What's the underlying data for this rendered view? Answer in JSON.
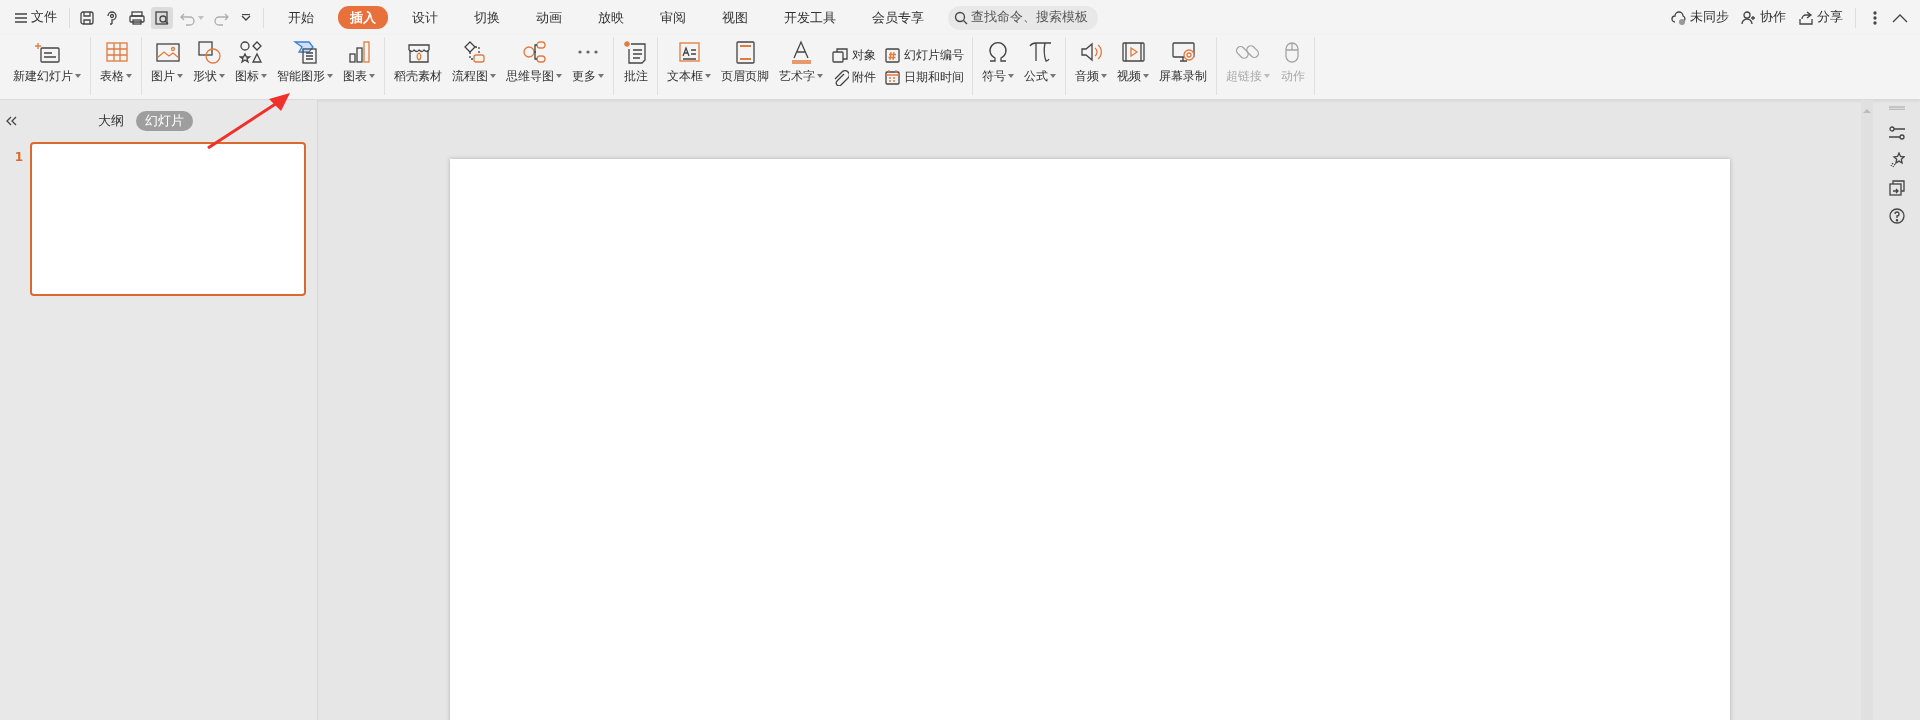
{
  "menu": {
    "file": "文件"
  },
  "quick_access": [
    {
      "selected": false,
      "disabled": false,
      "dropdown": false
    },
    {
      "selected": false,
      "disabled": false,
      "dropdown": false
    },
    {
      "selected": false,
      "disabled": false,
      "dropdown": false
    },
    {
      "selected": true,
      "disabled": false,
      "dropdown": false
    },
    {
      "selected": false,
      "disabled": true,
      "dropdown": true
    },
    {
      "selected": false,
      "disabled": true,
      "dropdown": false
    }
  ],
  "tabs": [
    {
      "label": "开始",
      "selected": false
    },
    {
      "label": "插入",
      "selected": true
    },
    {
      "label": "设计",
      "selected": false
    },
    {
      "label": "切换",
      "selected": false
    },
    {
      "label": "动画",
      "selected": false
    },
    {
      "label": "放映",
      "selected": false
    },
    {
      "label": "审阅",
      "selected": false
    },
    {
      "label": "视图",
      "selected": false
    },
    {
      "label": "开发工具",
      "selected": false
    },
    {
      "label": "会员专享",
      "selected": false
    }
  ],
  "search": {
    "placeholder": "查找命令、搜索模板"
  },
  "actions": [
    {
      "label": "未同步"
    },
    {
      "label": "协作"
    },
    {
      "label": "分享"
    }
  ],
  "ribbon": {
    "groups": [
      {
        "items": [
          {
            "kind": "big",
            "label": "新建幻灯片",
            "dropdown": true,
            "disabled": false
          }
        ]
      },
      {
        "items": [
          {
            "kind": "big",
            "label": "表格",
            "dropdown": true,
            "disabled": false
          }
        ]
      },
      {
        "items": [
          {
            "kind": "big",
            "label": "图片",
            "dropdown": true,
            "disabled": false
          },
          {
            "kind": "big",
            "label": "形状",
            "dropdown": true,
            "disabled": false
          },
          {
            "kind": "big",
            "label": "图标",
            "dropdown": true,
            "disabled": false
          },
          {
            "kind": "big",
            "label": "智能图形",
            "dropdown": true,
            "disabled": false
          },
          {
            "kind": "big",
            "label": "图表",
            "dropdown": true,
            "disabled": false
          }
        ]
      },
      {
        "items": [
          {
            "kind": "big",
            "label": "稻壳素材",
            "dropdown": false,
            "disabled": false
          },
          {
            "kind": "big",
            "label": "流程图",
            "dropdown": true,
            "disabled": false
          },
          {
            "kind": "big",
            "label": "思维导图",
            "dropdown": true,
            "disabled": false
          },
          {
            "kind": "big",
            "label": "更多",
            "dropdown": true,
            "disabled": false
          }
        ]
      },
      {
        "items": [
          {
            "kind": "big",
            "label": "批注",
            "dropdown": false,
            "disabled": false
          }
        ]
      },
      {
        "items": [
          {
            "kind": "big",
            "label": "文本框",
            "dropdown": true,
            "disabled": false
          },
          {
            "kind": "big",
            "label": "页眉页脚",
            "dropdown": false,
            "disabled": false
          },
          {
            "kind": "big",
            "label": "艺术字",
            "dropdown": true,
            "disabled": false
          },
          {
            "kind": "stack",
            "items": [
              {
                "label": "对象"
              },
              {
                "label": "附件"
              }
            ]
          },
          {
            "kind": "stack",
            "items": [
              {
                "label": "幻灯片编号"
              },
              {
                "label": "日期和时间"
              }
            ]
          }
        ]
      },
      {
        "items": [
          {
            "kind": "big",
            "label": "符号",
            "dropdown": true,
            "disabled": false
          },
          {
            "kind": "big",
            "label": "公式",
            "dropdown": true,
            "disabled": false
          }
        ]
      },
      {
        "items": [
          {
            "kind": "big",
            "label": "音频",
            "dropdown": true,
            "disabled": false
          },
          {
            "kind": "big",
            "label": "视频",
            "dropdown": true,
            "disabled": false
          },
          {
            "kind": "big",
            "label": "屏幕录制",
            "dropdown": false,
            "disabled": false
          }
        ]
      },
      {
        "items": [
          {
            "kind": "big",
            "label": "超链接",
            "dropdown": true,
            "disabled": true
          },
          {
            "kind": "big",
            "label": "动作",
            "dropdown": false,
            "disabled": true
          }
        ]
      }
    ]
  },
  "panel": {
    "tabs": [
      {
        "label": "大纲",
        "selected": false
      },
      {
        "label": "幻灯片",
        "selected": true
      }
    ],
    "slides": [
      {
        "number": "1",
        "selected": true
      }
    ]
  }
}
